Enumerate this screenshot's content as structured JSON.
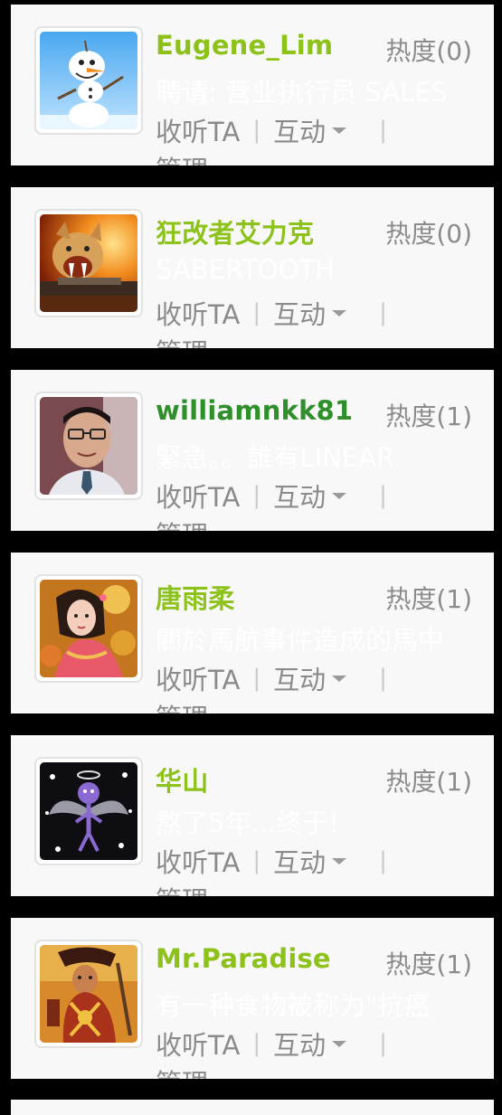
{
  "users": [
    {
      "name": "Eugene_Lim",
      "heat": "热度(0)",
      "snippet": "聘请: 营业执行员 SALES",
      "follow_label": "收听TA",
      "interact_label": "互动",
      "manage_label": "管理",
      "avatar_icon": "snowman-avatar"
    },
    {
      "name": "狂改者艾力克",
      "heat": "热度(0)",
      "snippet": "SABERTOOTH",
      "follow_label": "收听TA",
      "interact_label": "互动",
      "manage_label": "管理",
      "avatar_icon": "tiger-avatar"
    },
    {
      "name": "williamnkk81",
      "heat": "热度(1)",
      "snippet": "緊急。。誰有LINEAR",
      "follow_label": "收听TA",
      "interact_label": "互动",
      "manage_label": "管理",
      "avatar_icon": "person-photo-avatar"
    },
    {
      "name": "唐雨柔",
      "heat": "热度(1)",
      "snippet": "關於馬航事件造成的馬中",
      "follow_label": "收听TA",
      "interact_label": "互动",
      "manage_label": "管理",
      "avatar_icon": "woman-portrait-avatar"
    },
    {
      "name": "华山",
      "heat": "热度(1)",
      "snippet": "熬了5年...终于!",
      "follow_label": "收听TA",
      "interact_label": "互动",
      "manage_label": "管理",
      "avatar_icon": "angel-stickman-avatar"
    },
    {
      "name": "Mr.Paradise",
      "heat": "热度(1)",
      "snippet": "有一种食物被称为\"抗癌",
      "follow_label": "收听TA",
      "interact_label": "互动",
      "manage_label": "管理",
      "avatar_icon": "warrior-avatar"
    }
  ],
  "colors": {
    "name_green": "#8cc21a",
    "name_dark_green": "#2f8f2a",
    "muted_text": "#8b8b8b",
    "card_bg": "#f8f8f8",
    "page_bg": "#000000"
  }
}
